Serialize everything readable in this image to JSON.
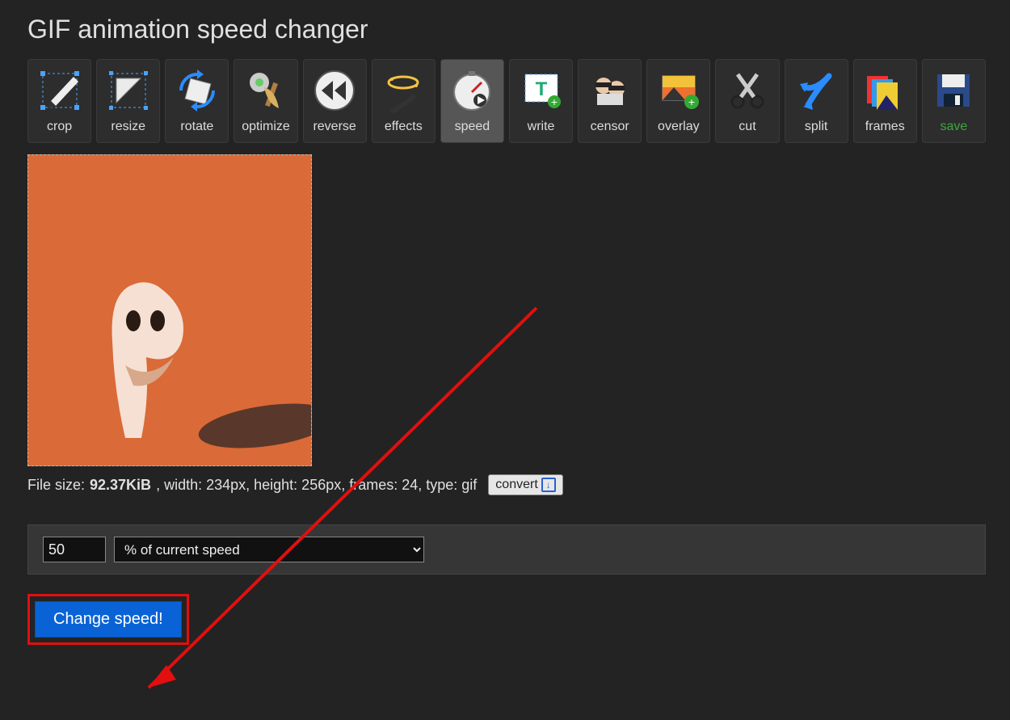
{
  "title": "GIF animation speed changer",
  "toolbar": [
    {
      "id": "crop",
      "label": "crop"
    },
    {
      "id": "resize",
      "label": "resize"
    },
    {
      "id": "rotate",
      "label": "rotate"
    },
    {
      "id": "optimize",
      "label": "optimize"
    },
    {
      "id": "reverse",
      "label": "reverse"
    },
    {
      "id": "effects",
      "label": "effects"
    },
    {
      "id": "speed",
      "label": "speed",
      "active": true
    },
    {
      "id": "write",
      "label": "write"
    },
    {
      "id": "censor",
      "label": "censor"
    },
    {
      "id": "overlay",
      "label": "overlay"
    },
    {
      "id": "cut",
      "label": "cut"
    },
    {
      "id": "split",
      "label": "split"
    },
    {
      "id": "frames",
      "label": "frames"
    },
    {
      "id": "save",
      "label": "save"
    }
  ],
  "file_info": {
    "size_label": "File size: ",
    "size": "92.37KiB",
    "rest": ", width: 234px, height: 256px, frames: 24, type: gif"
  },
  "convert_label": "convert",
  "speed_value": "50",
  "unit_option": "% of current speed",
  "submit_label": "Change speed!"
}
